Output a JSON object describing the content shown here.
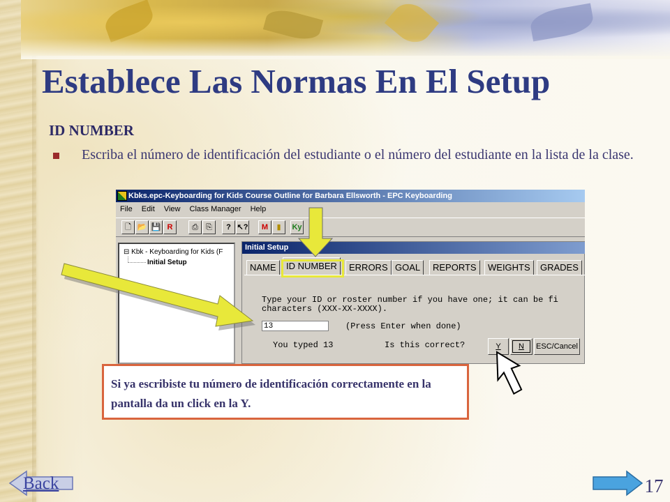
{
  "slide": {
    "title": "Establece Las Normas En El Setup",
    "subheading": "ID NUMBER",
    "bullet": "Escriba el número de identificación del estudiante o el número del estudiante en la lista de la clase.",
    "note": "Si ya escribiste tu número de identificación correctamente en la pantalla da un click en la Y.",
    "page_number": "17",
    "back_label": "Back",
    "accent_color": "#2e3b82",
    "note_border_color": "#d9653e",
    "arrow_color": "#e8e83a"
  },
  "app": {
    "window_title": "Kbks.epc-Keyboarding for Kids Course Outline for Barbara Ellsworth - EPC Keyboarding",
    "menu": [
      "File",
      "Edit",
      "View",
      "Class Manager",
      "Help"
    ],
    "toolbar_icons": [
      "new-icon",
      "open-icon",
      "save-icon",
      "report-icon",
      "print-icon",
      "print-preview-icon",
      "help-icon",
      "pointer-help-icon",
      "chart-icon",
      "bar-chart-icon",
      "keyboard-icon"
    ],
    "tree": {
      "root": "Kbk - Keyboarding for Kids (F",
      "child": "Initial Setup"
    },
    "panel_title": "Initial Setup",
    "tabs": [
      "NAME",
      "ID NUMBER",
      "ERRORS",
      "GOAL",
      "REPORTS",
      "WEIGHTS",
      "GRADES"
    ],
    "active_tab": "ID NUMBER",
    "prompt_line1": "Type your ID or roster number if you have one; it can be fi",
    "prompt_line2": "characters (XXX-XX-XXXX).",
    "id_value": "13",
    "press_enter": "(Press Enter when done)",
    "you_typed": "You typed 13",
    "confirm_question": "Is this correct?",
    "buttons": {
      "yes": "Y",
      "no": "N",
      "cancel": "ESC/Cancel"
    }
  }
}
